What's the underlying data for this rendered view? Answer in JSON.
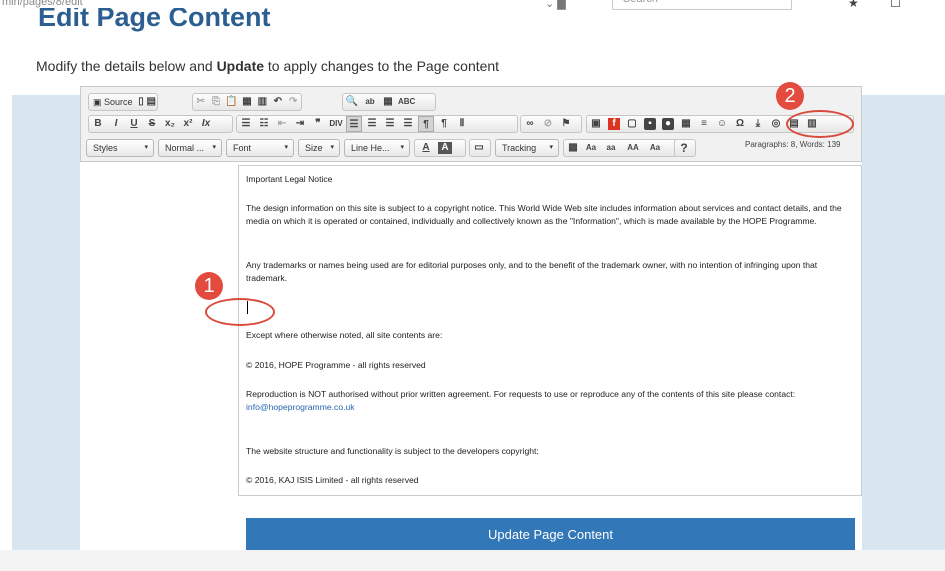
{
  "browser": {
    "url": "min/pages/8/edit",
    "search_placeholder": "Search"
  },
  "page": {
    "title": "Edit Page Content",
    "subtitle_prefix": "Modify the details below and ",
    "subtitle_bold": "Update",
    "subtitle_suffix": " to apply changes to the Page content"
  },
  "toolbar": {
    "source_label": "Source",
    "row2_buttons": [
      "B",
      "I",
      "U",
      "S",
      "x₂",
      "x²",
      "Ix"
    ],
    "styles_label": "Styles",
    "format_label": "Normal ...",
    "font_label": "Font",
    "size_label": "Size",
    "lineheight_label": "Line He...",
    "textcolor_label": "A",
    "bgcolor_label": "A",
    "tracking_label": "Tracking",
    "case_labels": [
      "aa",
      "AA",
      "Aa"
    ],
    "help_label": "?",
    "status": "Paragraphs: 8, Words: 139"
  },
  "editor": {
    "paragraphs": [
      "Important Legal Notice",
      "The design information on this site is subject to a copyright notice. This World Wide Web site includes information about services and contact details, and the media on which it is operated or contained, individually and collectively known as the \"Information\", which is made available by the HOPE Programme.",
      "Any trademarks or names being used are for editorial purposes only, and to the benefit of the trademark owner, with no intention of infringing upon that trademark.",
      "Except where otherwise noted, all site contents are:",
      "© 2016, HOPE Programme - all rights reserved",
      "Reproduction is NOT authorised without prior written agreement. For requests to use or reproduce any of the contents of this site please contact: ",
      "The website structure and functionality is subject to the developers copyright:",
      "© 2016, KAJ ISIS Limited - all rights reserved"
    ],
    "contact_link": "info@hopeprogramme.co.uk"
  },
  "actions": {
    "update_label": "Update Page Content"
  },
  "annotations": {
    "badge1": "1",
    "badge2": "2",
    "color": "#e34b3e"
  },
  "colors": {
    "title": "#2b5e91",
    "button": "#3277b7",
    "background": "#d9e6ef"
  }
}
